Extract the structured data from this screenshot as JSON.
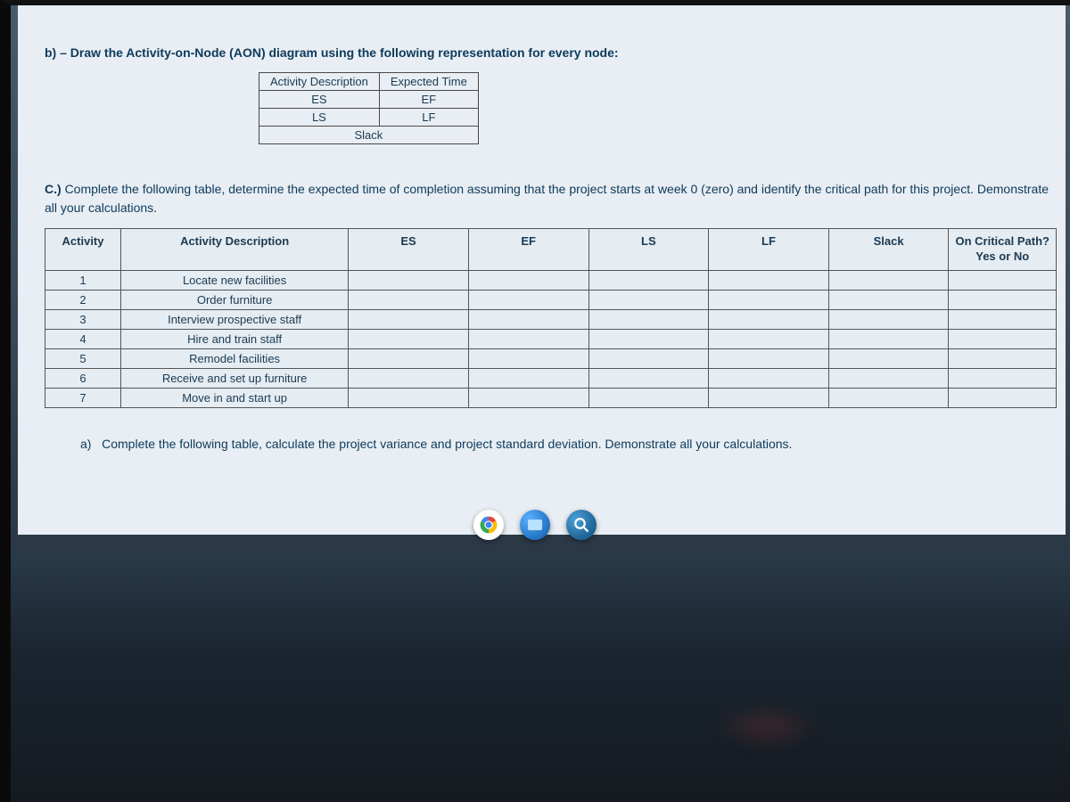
{
  "section_b": {
    "label": "b)",
    "text": "– Draw the Activity-on-Node (AON) diagram using the following representation for every node:"
  },
  "node_legend": {
    "r1c1": "Activity Description",
    "r1c2": "Expected Time",
    "r2c1": "ES",
    "r2c2": "EF",
    "r3c1": "LS",
    "r3c2": "LF",
    "r4": "Slack"
  },
  "section_c": {
    "label": "C.)",
    "text": "Complete the following table, determine the expected time of completion assuming that the project starts at week 0 (zero) and identify the critical path for this project. Demonstrate all your calculations."
  },
  "table": {
    "headers": {
      "activity": "Activity",
      "desc": "Activity Description",
      "es": "ES",
      "ef": "EF",
      "ls": "LS",
      "lf": "LF",
      "slack": "Slack",
      "crit": "On Critical Path?",
      "crit_sub": "Yes or No"
    },
    "rows": [
      {
        "n": "1",
        "desc": "Locate new facilities"
      },
      {
        "n": "2",
        "desc": "Order furniture"
      },
      {
        "n": "3",
        "desc": "Interview prospective staff"
      },
      {
        "n": "4",
        "desc": "Hire and train staff"
      },
      {
        "n": "5",
        "desc": "Remodel facilities"
      },
      {
        "n": "6",
        "desc": "Receive and set up furniture"
      },
      {
        "n": "7",
        "desc": "Move in and start up"
      }
    ]
  },
  "section_a": {
    "label": "a)",
    "text": "Complete the following table, calculate the project variance and project standard deviation. Demonstrate all your calculations."
  }
}
